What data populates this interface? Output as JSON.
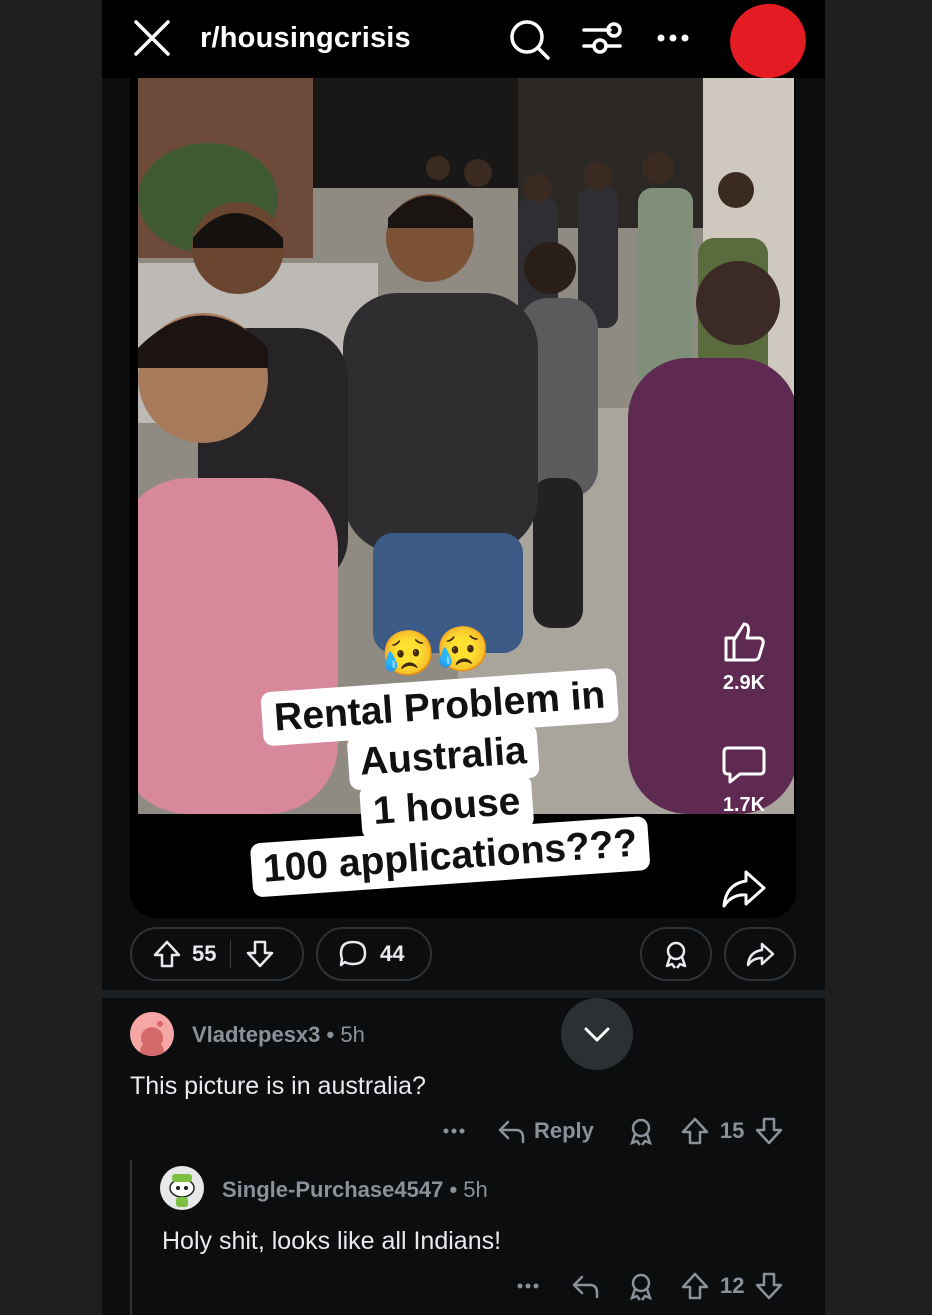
{
  "header": {
    "subreddit": "r/housingcrisis",
    "icons": [
      "close-icon",
      "search-icon",
      "filter-icon",
      "more-icon"
    ]
  },
  "post": {
    "caption_emojis": "😥😥",
    "caption_lines": [
      "Rental Problem in",
      "Australia",
      "1 house",
      "100 applications???"
    ],
    "video_likes": "2.9K",
    "video_comments": "1.7K",
    "upvotes": "55",
    "comments": "44"
  },
  "comments": [
    {
      "username": "Vladtepesx3",
      "time": "5h",
      "body": "This picture is in australia?",
      "reply_label": "Reply",
      "score": "15",
      "avatar_color": "#f7a6a6"
    },
    {
      "username": "Single-Purchase4547",
      "time": "5h",
      "body": "Holy shit, looks like all Indians!",
      "score": "12",
      "avatar_color": "#e8e8e8"
    }
  ],
  "colors": {
    "background": "#0b0d0f",
    "header": "#000000",
    "redacted_avatar": "#e31b23",
    "muted_text": "#8b9199"
  }
}
